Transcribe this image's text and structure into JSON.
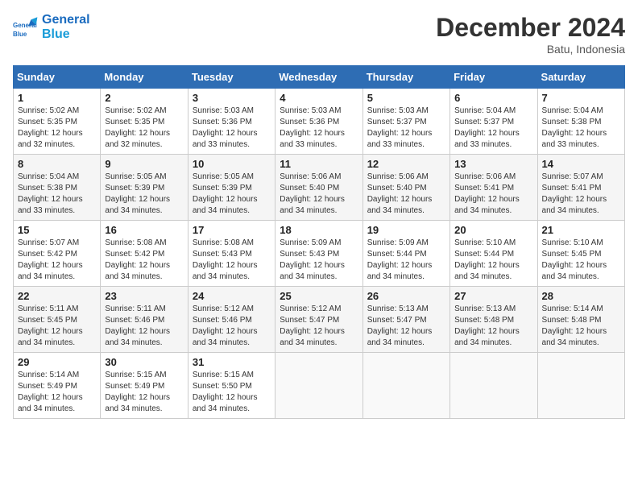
{
  "header": {
    "logo_line1": "General",
    "logo_line2": "Blue",
    "month": "December 2024",
    "location": "Batu, Indonesia"
  },
  "weekdays": [
    "Sunday",
    "Monday",
    "Tuesday",
    "Wednesday",
    "Thursday",
    "Friday",
    "Saturday"
  ],
  "weeks": [
    [
      {
        "day": "1",
        "sunrise": "5:02 AM",
        "sunset": "5:35 PM",
        "daylight": "12 hours and 32 minutes."
      },
      {
        "day": "2",
        "sunrise": "5:02 AM",
        "sunset": "5:35 PM",
        "daylight": "12 hours and 32 minutes."
      },
      {
        "day": "3",
        "sunrise": "5:03 AM",
        "sunset": "5:36 PM",
        "daylight": "12 hours and 33 minutes."
      },
      {
        "day": "4",
        "sunrise": "5:03 AM",
        "sunset": "5:36 PM",
        "daylight": "12 hours and 33 minutes."
      },
      {
        "day": "5",
        "sunrise": "5:03 AM",
        "sunset": "5:37 PM",
        "daylight": "12 hours and 33 minutes."
      },
      {
        "day": "6",
        "sunrise": "5:04 AM",
        "sunset": "5:37 PM",
        "daylight": "12 hours and 33 minutes."
      },
      {
        "day": "7",
        "sunrise": "5:04 AM",
        "sunset": "5:38 PM",
        "daylight": "12 hours and 33 minutes."
      }
    ],
    [
      {
        "day": "8",
        "sunrise": "5:04 AM",
        "sunset": "5:38 PM",
        "daylight": "12 hours and 33 minutes."
      },
      {
        "day": "9",
        "sunrise": "5:05 AM",
        "sunset": "5:39 PM",
        "daylight": "12 hours and 34 minutes."
      },
      {
        "day": "10",
        "sunrise": "5:05 AM",
        "sunset": "5:39 PM",
        "daylight": "12 hours and 34 minutes."
      },
      {
        "day": "11",
        "sunrise": "5:06 AM",
        "sunset": "5:40 PM",
        "daylight": "12 hours and 34 minutes."
      },
      {
        "day": "12",
        "sunrise": "5:06 AM",
        "sunset": "5:40 PM",
        "daylight": "12 hours and 34 minutes."
      },
      {
        "day": "13",
        "sunrise": "5:06 AM",
        "sunset": "5:41 PM",
        "daylight": "12 hours and 34 minutes."
      },
      {
        "day": "14",
        "sunrise": "5:07 AM",
        "sunset": "5:41 PM",
        "daylight": "12 hours and 34 minutes."
      }
    ],
    [
      {
        "day": "15",
        "sunrise": "5:07 AM",
        "sunset": "5:42 PM",
        "daylight": "12 hours and 34 minutes."
      },
      {
        "day": "16",
        "sunrise": "5:08 AM",
        "sunset": "5:42 PM",
        "daylight": "12 hours and 34 minutes."
      },
      {
        "day": "17",
        "sunrise": "5:08 AM",
        "sunset": "5:43 PM",
        "daylight": "12 hours and 34 minutes."
      },
      {
        "day": "18",
        "sunrise": "5:09 AM",
        "sunset": "5:43 PM",
        "daylight": "12 hours and 34 minutes."
      },
      {
        "day": "19",
        "sunrise": "5:09 AM",
        "sunset": "5:44 PM",
        "daylight": "12 hours and 34 minutes."
      },
      {
        "day": "20",
        "sunrise": "5:10 AM",
        "sunset": "5:44 PM",
        "daylight": "12 hours and 34 minutes."
      },
      {
        "day": "21",
        "sunrise": "5:10 AM",
        "sunset": "5:45 PM",
        "daylight": "12 hours and 34 minutes."
      }
    ],
    [
      {
        "day": "22",
        "sunrise": "5:11 AM",
        "sunset": "5:45 PM",
        "daylight": "12 hours and 34 minutes."
      },
      {
        "day": "23",
        "sunrise": "5:11 AM",
        "sunset": "5:46 PM",
        "daylight": "12 hours and 34 minutes."
      },
      {
        "day": "24",
        "sunrise": "5:12 AM",
        "sunset": "5:46 PM",
        "daylight": "12 hours and 34 minutes."
      },
      {
        "day": "25",
        "sunrise": "5:12 AM",
        "sunset": "5:47 PM",
        "daylight": "12 hours and 34 minutes."
      },
      {
        "day": "26",
        "sunrise": "5:13 AM",
        "sunset": "5:47 PM",
        "daylight": "12 hours and 34 minutes."
      },
      {
        "day": "27",
        "sunrise": "5:13 AM",
        "sunset": "5:48 PM",
        "daylight": "12 hours and 34 minutes."
      },
      {
        "day": "28",
        "sunrise": "5:14 AM",
        "sunset": "5:48 PM",
        "daylight": "12 hours and 34 minutes."
      }
    ],
    [
      {
        "day": "29",
        "sunrise": "5:14 AM",
        "sunset": "5:49 PM",
        "daylight": "12 hours and 34 minutes."
      },
      {
        "day": "30",
        "sunrise": "5:15 AM",
        "sunset": "5:49 PM",
        "daylight": "12 hours and 34 minutes."
      },
      {
        "day": "31",
        "sunrise": "5:15 AM",
        "sunset": "5:50 PM",
        "daylight": "12 hours and 34 minutes."
      },
      null,
      null,
      null,
      null
    ]
  ]
}
